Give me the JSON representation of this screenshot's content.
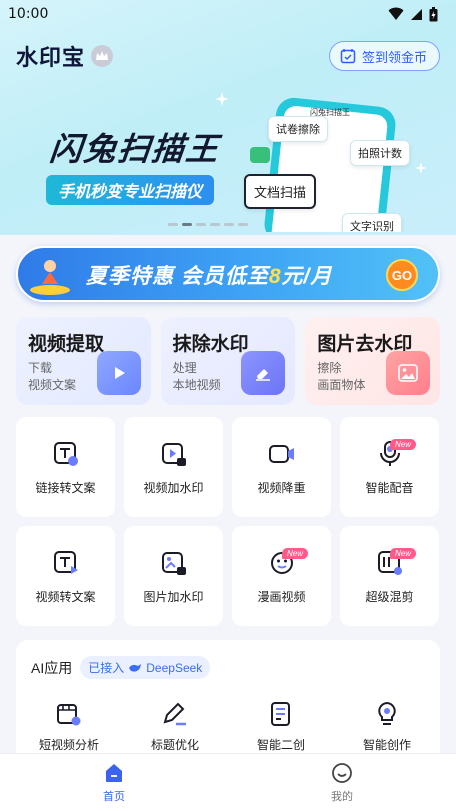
{
  "status_bar": {
    "time": "10:00",
    "icons": [
      "wifi-icon",
      "signal-icon",
      "battery-icon"
    ]
  },
  "header": {
    "title": "水印宝",
    "crown_icon": "crown-icon",
    "checkin_label": "签到领金币",
    "checkin_icon": "calendar-check-icon"
  },
  "banner": {
    "title": "闪兔扫描王",
    "subtitle": "手机秒变专业扫描仪",
    "phone_label": "闪兔扫描王",
    "tags": [
      "试卷擦除",
      "拍照计数",
      "文档扫描",
      "文字识别"
    ],
    "dot_count": 6,
    "active_dot": 1
  },
  "promo": {
    "text_prefix": "夏季特惠  会员低至",
    "highlight": "8",
    "text_suffix": "元/月",
    "go_label": "GO"
  },
  "feature_cards": [
    {
      "title": "视频提取",
      "line1": "下载",
      "line2": "视频文案",
      "icon": "play-icon"
    },
    {
      "title": "抹除水印",
      "line1": "处理",
      "line2": "本地视频",
      "icon": "eraser-icon"
    },
    {
      "title": "图片去水印",
      "line1": "擦除",
      "line2": "画面物体",
      "icon": "image-icon"
    }
  ],
  "tools_row1": [
    {
      "label": "链接转文案",
      "icon": "link-text-icon",
      "new": ""
    },
    {
      "label": "视频加水印",
      "icon": "video-watermark-icon",
      "new": ""
    },
    {
      "label": "视频降重",
      "icon": "video-camera-icon",
      "new": ""
    },
    {
      "label": "智能配音",
      "icon": "microphone-icon",
      "new": "New"
    }
  ],
  "tools_row2": [
    {
      "label": "视频转文案",
      "icon": "video-text-icon",
      "new": ""
    },
    {
      "label": "图片加水印",
      "icon": "image-watermark-icon",
      "new": ""
    },
    {
      "label": "漫画视频",
      "icon": "comic-video-icon",
      "new": "New"
    },
    {
      "label": "超级混剪",
      "icon": "mix-cut-icon",
      "new": "New"
    }
  ],
  "ai_section": {
    "title": "AI应用",
    "chip_prefix": "已接入",
    "chip_name": "DeepSeek",
    "items": [
      {
        "label": "短视频分析",
        "icon": "film-analysis-icon"
      },
      {
        "label": "标题优化",
        "icon": "pen-ai-icon"
      },
      {
        "label": "智能二创",
        "icon": "doc-ai-icon"
      },
      {
        "label": "智能创作",
        "icon": "bulb-ai-icon"
      }
    ]
  },
  "bottom_nav": [
    {
      "label": "首页",
      "icon": "home-icon",
      "active": true
    },
    {
      "label": "我的",
      "icon": "profile-icon",
      "active": false
    }
  ],
  "colors": {
    "accent": "#3b63f0",
    "promo": "#2f7be8",
    "new_badge": "#ff5a8a"
  }
}
